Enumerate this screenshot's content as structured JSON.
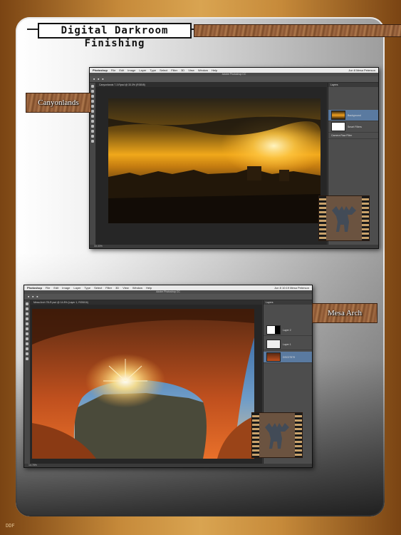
{
  "page": {
    "title": "Digital Darkroom Finishing",
    "folio": "DDF"
  },
  "screen1": {
    "label": "Canyonlands",
    "app_title": "Adobe Photoshop CC",
    "menu": [
      "Photoshop",
      "File",
      "Edit",
      "Image",
      "Layer",
      "Type",
      "Select",
      "Filter",
      "3D",
      "View",
      "Window",
      "Help"
    ],
    "menu_right": "Jun 8  Mesa Peterson",
    "doc_tab": "Canyonlands 7-3.Rpsd @ 33.3% (RGB/8)",
    "status": "33.33%",
    "layers": [
      "Background",
      "Smart Filters",
      "Camera Raw Filter"
    ]
  },
  "screen2": {
    "label": "Mesa Arch",
    "app_title": "Adobe Photoshop CC",
    "menu": [
      "Photoshop",
      "File",
      "Edit",
      "Image",
      "Layer",
      "Type",
      "Select",
      "Filter",
      "3D",
      "View",
      "Window",
      "Help"
    ],
    "menu_right": "Jun 8  10:19  Mesa Peterson",
    "doc_tab": "Mesa Arch 7B-R.psd @ 14.8% (Layer 1, RGB/16)",
    "status": "14.78%",
    "layers": [
      "Layer 2",
      "Layer 1",
      "DSC07579"
    ]
  },
  "icons": [
    "moose-icon"
  ],
  "colors": {
    "accent": "#a7661d",
    "wood": "#8a5532"
  }
}
